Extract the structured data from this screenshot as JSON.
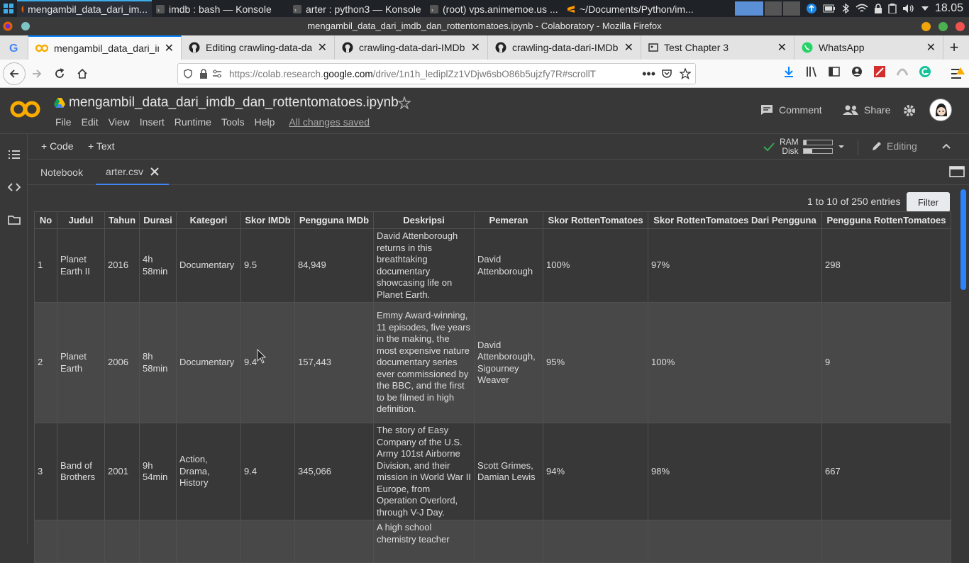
{
  "taskbar": {
    "tasks": [
      {
        "label": "mengambil_data_dari_im...",
        "icon": "firefox-icon",
        "active": true
      },
      {
        "label": "imdb : bash — Konsole",
        "icon": "terminal-icon",
        "active": false
      },
      {
        "label": "arter : python3 — Konsole",
        "icon": "terminal-icon",
        "active": false
      },
      {
        "label": "(root) vps.animemoe.us ...",
        "icon": "terminal-icon",
        "active": false
      },
      {
        "label": "~/Documents/Python/im...",
        "icon": "sublime-icon",
        "active": false
      }
    ],
    "clock": "18.05"
  },
  "window": {
    "title": "mengambil_data_dari_imdb_dan_rottentomatoes.ipynb - Colaboratory - Mozilla Firefox"
  },
  "browser_tabs": [
    {
      "label": "mengambil_data_dari_imdb_dan_rottentomatoes.ipynb",
      "icon": "colab-icon",
      "active": true
    },
    {
      "label": "Editing crawling-data-dari-IMDb",
      "icon": "github-icon",
      "active": false
    },
    {
      "label": "crawling-data-dari-IMDb-dan-Rotten",
      "icon": "github-icon",
      "active": false
    },
    {
      "label": "crawling-data-dari-IMDb-dan-Rotten",
      "icon": "github-icon",
      "active": false
    },
    {
      "label": "Test Chapter 3",
      "icon": "page-icon",
      "active": false
    },
    {
      "label": "WhatsApp",
      "icon": "whatsapp-icon",
      "active": false
    }
  ],
  "address": {
    "prefix": "https://colab.research.",
    "domain": "google.com",
    "suffix": "/drive/1n1h_lediplZz1VDjw6sbO86b5ujzfy7R#scrollT"
  },
  "colab": {
    "notebook_title": "mengambil_data_dari_imdb_dan_rottentomatoes.ipynb",
    "menu": [
      "File",
      "Edit",
      "View",
      "Insert",
      "Runtime",
      "Tools",
      "Help"
    ],
    "save_status": "All changes saved",
    "comment": "Comment",
    "share": "Share",
    "add_code": "+ Code",
    "add_text": "+ Text",
    "ram": "RAM",
    "disk": "Disk",
    "editing": "Editing",
    "subtabs": [
      {
        "label": "Notebook",
        "active": false
      },
      {
        "label": "arter.csv",
        "active": true
      }
    ],
    "entries": "1 to 10 of 250 entries",
    "filter": "Filter"
  },
  "table": {
    "headers": [
      "No",
      "Judul",
      "Tahun",
      "Durasi",
      "Kategori",
      "Skor IMDb",
      "Pengguna IMDb",
      "Deskripsi",
      "Pemeran",
      "Skor RottenTomatoes",
      "Skor RottenTomatoes Dari Pengguna",
      "Pengguna RottenTomatoes"
    ],
    "rows": [
      [
        "1",
        "Planet Earth II",
        "2016",
        "4h 58min",
        "Documentary",
        "9.5",
        "84,949",
        "David Attenborough returns in this breathtaking documentary showcasing life on Planet Earth.",
        "David Attenborough",
        "100%",
        "97%",
        "298"
      ],
      [
        "2",
        "Planet Earth",
        "2006",
        "8h 58min",
        "Documentary",
        "9.4",
        "157,443",
        "Emmy Award-winning, 11 episodes, five years in the making, the most expensive nature documentary series ever commissioned by the BBC, and the first to be filmed in high definition.",
        "David Attenborough, Sigourney Weaver",
        "95%",
        "100%",
        "9"
      ],
      [
        "3",
        "Band of Brothers",
        "2001",
        "9h 54min",
        "Action, Drama, History",
        "9.4",
        "345,066",
        "The story of Easy Company of the U.S. Army 101st Airborne Division, and their mission in World War II Europe, from Operation Overlord, through V-J Day.",
        "Scott Grimes, Damian Lewis",
        "94%",
        "98%",
        "667"
      ],
      [
        "",
        "",
        "",
        "",
        "",
        "",
        "",
        "A high school chemistry teacher",
        "",
        "",
        "",
        ""
      ]
    ]
  },
  "colors": {
    "accent": "#0a84ff",
    "colab_orange": "#f9ab00",
    "panel": "#383838"
  }
}
